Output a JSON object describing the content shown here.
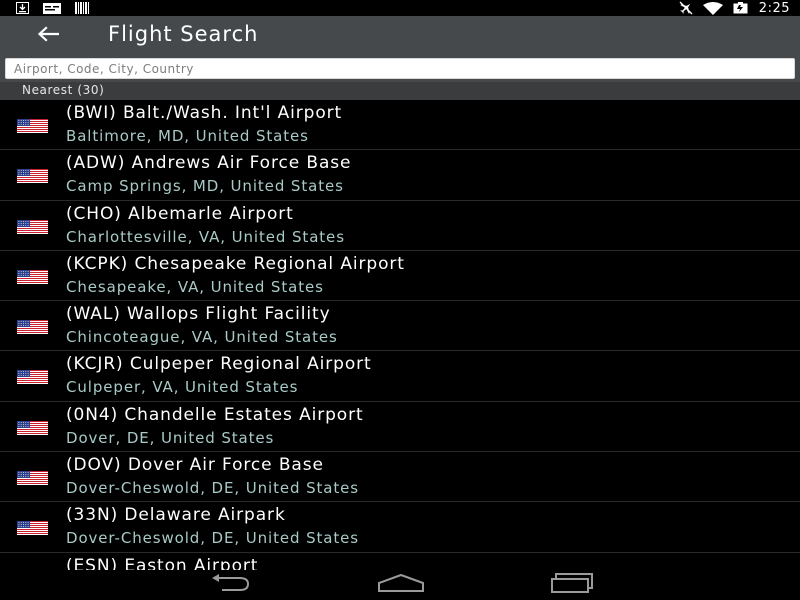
{
  "status_bar": {
    "time": "2:25",
    "left_icons": [
      "download-icon",
      "message-icon",
      "barcode-icon"
    ],
    "right_icons": [
      "airplane-mode-icon",
      "wifi-icon",
      "battery-icon"
    ]
  },
  "header": {
    "title": "Flight Search",
    "back_icon": "arrow-left-icon"
  },
  "search": {
    "placeholder": "Airport, Code, City, Country",
    "value": ""
  },
  "section": {
    "label": "Nearest (30)"
  },
  "airports": [
    {
      "name": "(BWI) Balt./Wash. Int'l Airport",
      "location": "Baltimore, MD, United States",
      "flag": "us-flag-icon"
    },
    {
      "name": "(ADW) Andrews Air Force Base",
      "location": "Camp Springs, MD, United States",
      "flag": "us-flag-icon"
    },
    {
      "name": "(CHO) Albemarle Airport",
      "location": "Charlottesville, VA, United States",
      "flag": "us-flag-icon"
    },
    {
      "name": "(KCPK) Chesapeake Regional Airport",
      "location": "Chesapeake, VA, United States",
      "flag": "us-flag-icon"
    },
    {
      "name": "(WAL) Wallops Flight Facility",
      "location": "Chincoteague, VA, United States",
      "flag": "us-flag-icon"
    },
    {
      "name": "(KCJR) Culpeper Regional Airport",
      "location": "Culpeper, VA, United States",
      "flag": "us-flag-icon"
    },
    {
      "name": "(0N4) Chandelle Estates Airport",
      "location": "Dover, DE, United States",
      "flag": "us-flag-icon"
    },
    {
      "name": "(DOV) Dover Air Force Base",
      "location": "Dover-Cheswold, DE, United States",
      "flag": "us-flag-icon"
    },
    {
      "name": "(33N) Delaware Airpark",
      "location": "Dover-Cheswold, DE, United States",
      "flag": "us-flag-icon"
    },
    {
      "name": "(ESN) Easton Airport",
      "location": "",
      "flag": "us-flag-icon"
    }
  ],
  "nav_bar": {
    "icons": [
      "nav-back-icon",
      "nav-home-icon",
      "nav-recent-apps-icon"
    ]
  },
  "colors": {
    "app_bar": "#46494c",
    "section_header": "#3a3c3e",
    "location_text": "#a8cac6",
    "background": "#000000"
  }
}
